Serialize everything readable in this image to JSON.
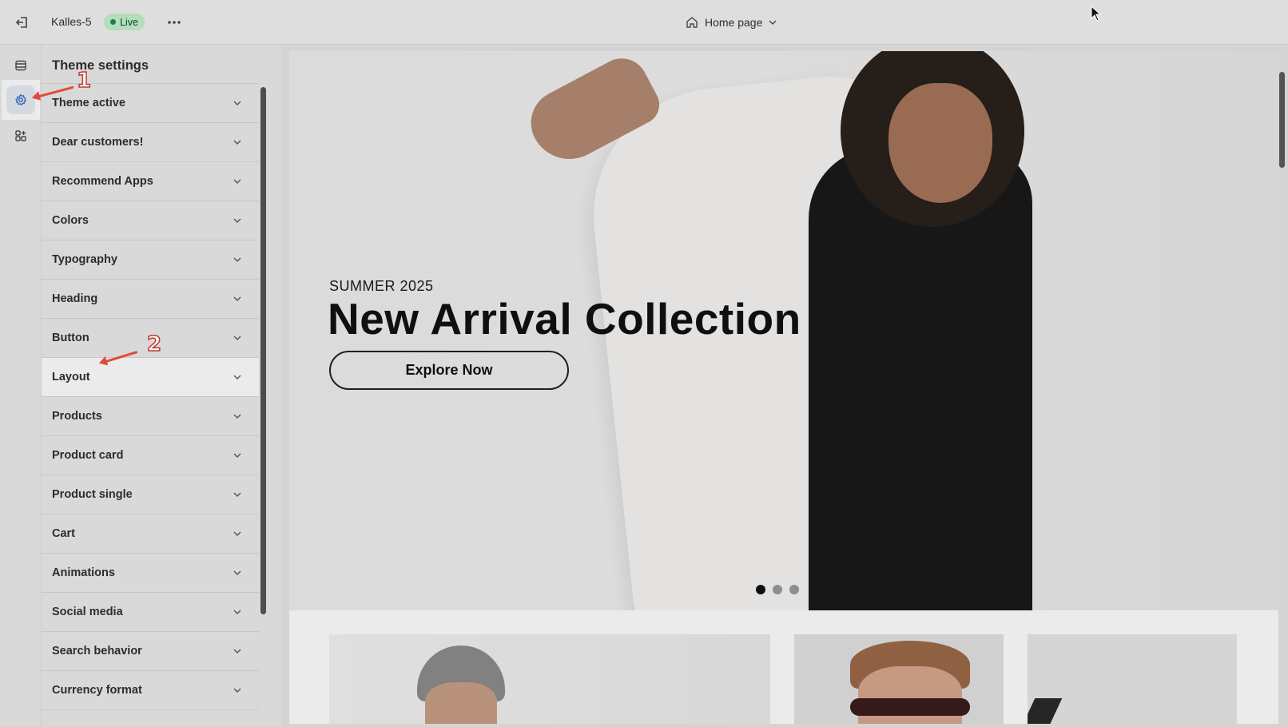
{
  "topbar": {
    "store_name": "Kalles-5",
    "status_badge": "Live",
    "page_selector": "Home page",
    "icons": {
      "exit": "exit-icon",
      "more": "more-icon",
      "home": "home-icon",
      "chevron": "chevron-down-icon"
    }
  },
  "rail": {
    "items": [
      {
        "name": "sections",
        "icon": "sections-icon"
      },
      {
        "name": "theme-settings",
        "icon": "gear-icon",
        "active": true
      },
      {
        "name": "apps",
        "icon": "apps-icon"
      }
    ]
  },
  "panel": {
    "title": "Theme settings",
    "items": [
      "Theme active",
      "Dear customers!",
      "Recommend Apps",
      "Colors",
      "Typography",
      "Heading",
      "Button",
      "Layout",
      "Products",
      "Product card",
      "Product single",
      "Cart",
      "Animations",
      "Social media",
      "Search behavior",
      "Currency format"
    ],
    "highlighted_item": "Layout"
  },
  "preview": {
    "hero": {
      "kicker": "SUMMER 2025",
      "title": "New Arrival Collection",
      "button": "Explore Now",
      "slides_total": 3,
      "active_slide": 1
    }
  },
  "annotations": {
    "step1": "1",
    "step2": "2",
    "color": "#e04a3a"
  },
  "colors": {
    "accent": "#2c6ecb",
    "live_badge_bg": "#c4f0cd",
    "live_badge_text": "#0c5132",
    "live_dot": "#29845a"
  }
}
